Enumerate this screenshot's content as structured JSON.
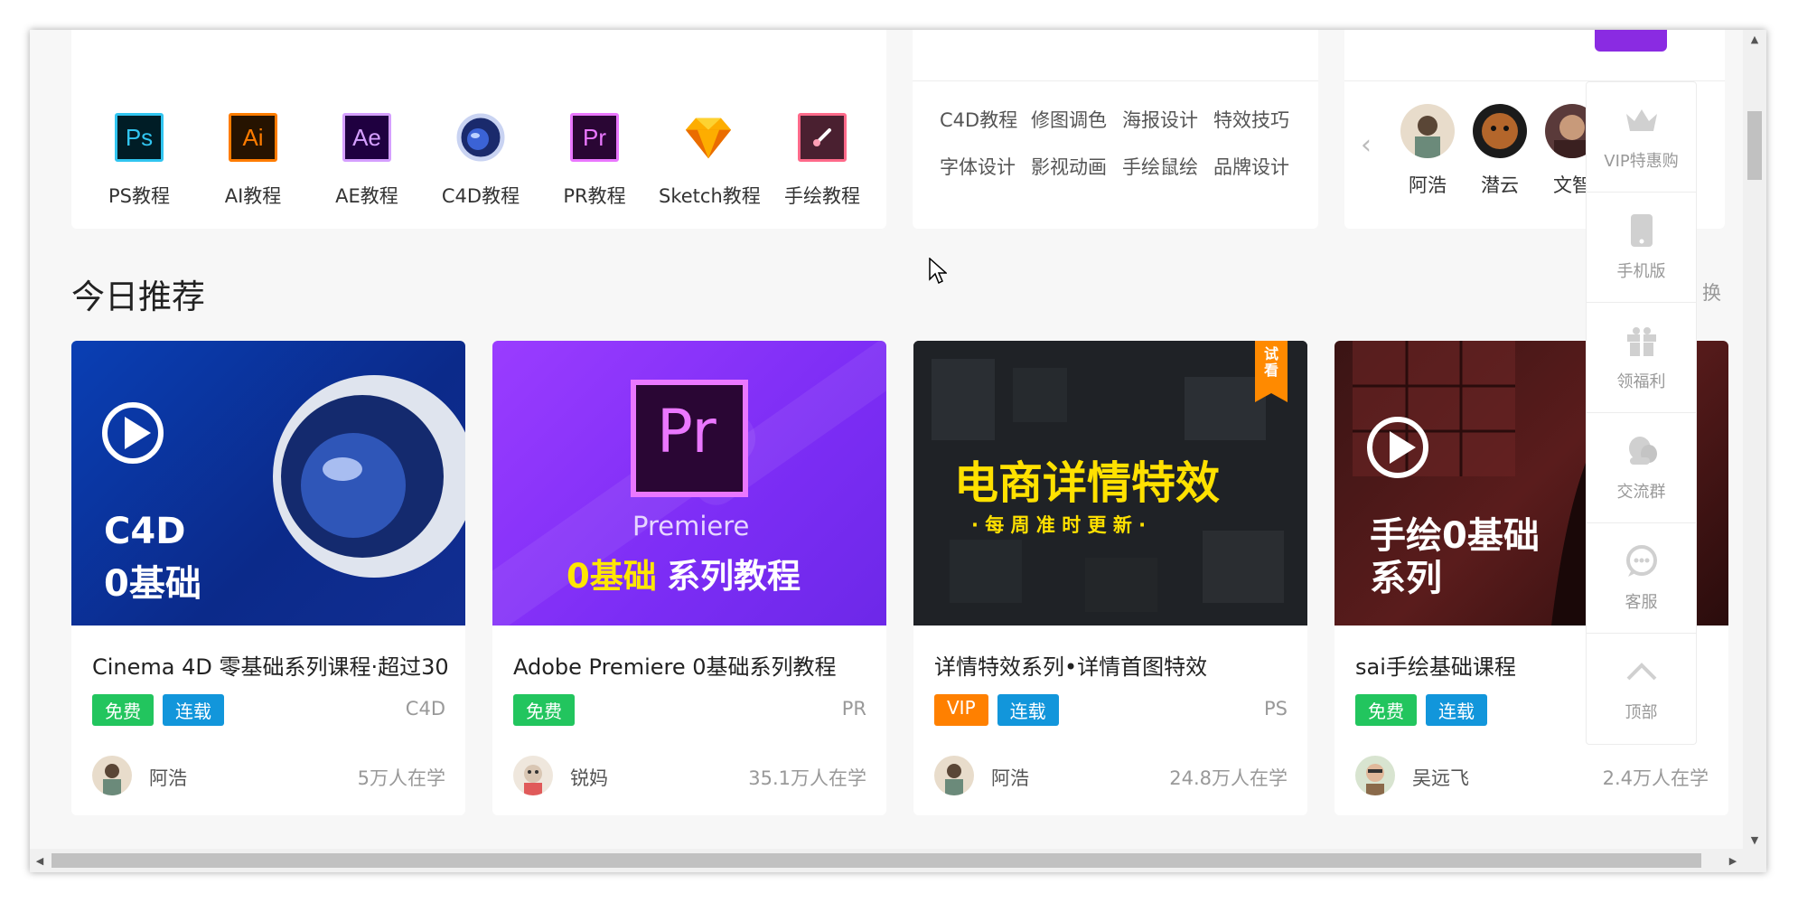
{
  "software": [
    {
      "icon_text": "Ps",
      "label": "PS教程"
    },
    {
      "icon_text": "Ai",
      "label": "AI教程"
    },
    {
      "icon_text": "Ae",
      "label": "AE教程"
    },
    {
      "icon_text": "",
      "label": "C4D教程"
    },
    {
      "icon_text": "Pr",
      "label": "PR教程"
    },
    {
      "icon_text": "",
      "label": "Sketch教程"
    },
    {
      "icon_text": "",
      "label": "手绘教程"
    }
  ],
  "tags": [
    "C4D教程",
    "修图调色",
    "海报设计",
    "特效技巧",
    "字体设计",
    "影视动画",
    "手绘鼠绘",
    "品牌设计"
  ],
  "teachers": [
    "阿浩",
    "潜云",
    "文智"
  ],
  "section": {
    "title": "今日推荐",
    "refresh": "换"
  },
  "courses": [
    {
      "thumb_title_1": "C4D",
      "thumb_title_2": "0基础",
      "title": "Cinema 4D 零基础系列课程·超过30",
      "badges": [
        "免费",
        "连载"
      ],
      "category": "C4D",
      "author": "阿浩",
      "learners": "5万人在学"
    },
    {
      "thumb_logo": "Pr",
      "thumb_title_1": "Premiere",
      "thumb_title_2a": "0基础",
      "thumb_title_2b": "系列教程",
      "title": "Adobe Premiere 0基础系列教程",
      "badges": [
        "免费"
      ],
      "category": "PR",
      "author": "锐妈",
      "learners": "35.1万人在学"
    },
    {
      "thumb_ribbon": "试看",
      "thumb_title_1": "电商详情特效",
      "thumb_title_2": "· 每 周 准 时 更 新 ·",
      "title": "详情特效系列•详情首图特效",
      "badges": [
        "VIP",
        "连载"
      ],
      "category": "PS",
      "author": "阿浩",
      "learners": "24.8万人在学"
    },
    {
      "thumb_title_1": "手绘0基础",
      "thumb_title_2": "系列",
      "title": "sai手绘基础课程",
      "badges": [
        "免费",
        "连载"
      ],
      "category": "",
      "author": "吴远飞",
      "learners": "2.4万人在学"
    }
  ],
  "float_bar": [
    {
      "icon": "crown-icon",
      "label": "VIP特惠购"
    },
    {
      "icon": "phone-icon",
      "label": "手机版"
    },
    {
      "icon": "gift-icon",
      "label": "领福利"
    },
    {
      "icon": "chat-group-icon",
      "label": "交流群"
    },
    {
      "icon": "support-icon",
      "label": "客服"
    },
    {
      "icon": "chevron-up-icon",
      "label": "顶部"
    }
  ],
  "colors": {
    "free": "#22c55e",
    "serial": "#1296db",
    "vip": "#ff8000"
  }
}
